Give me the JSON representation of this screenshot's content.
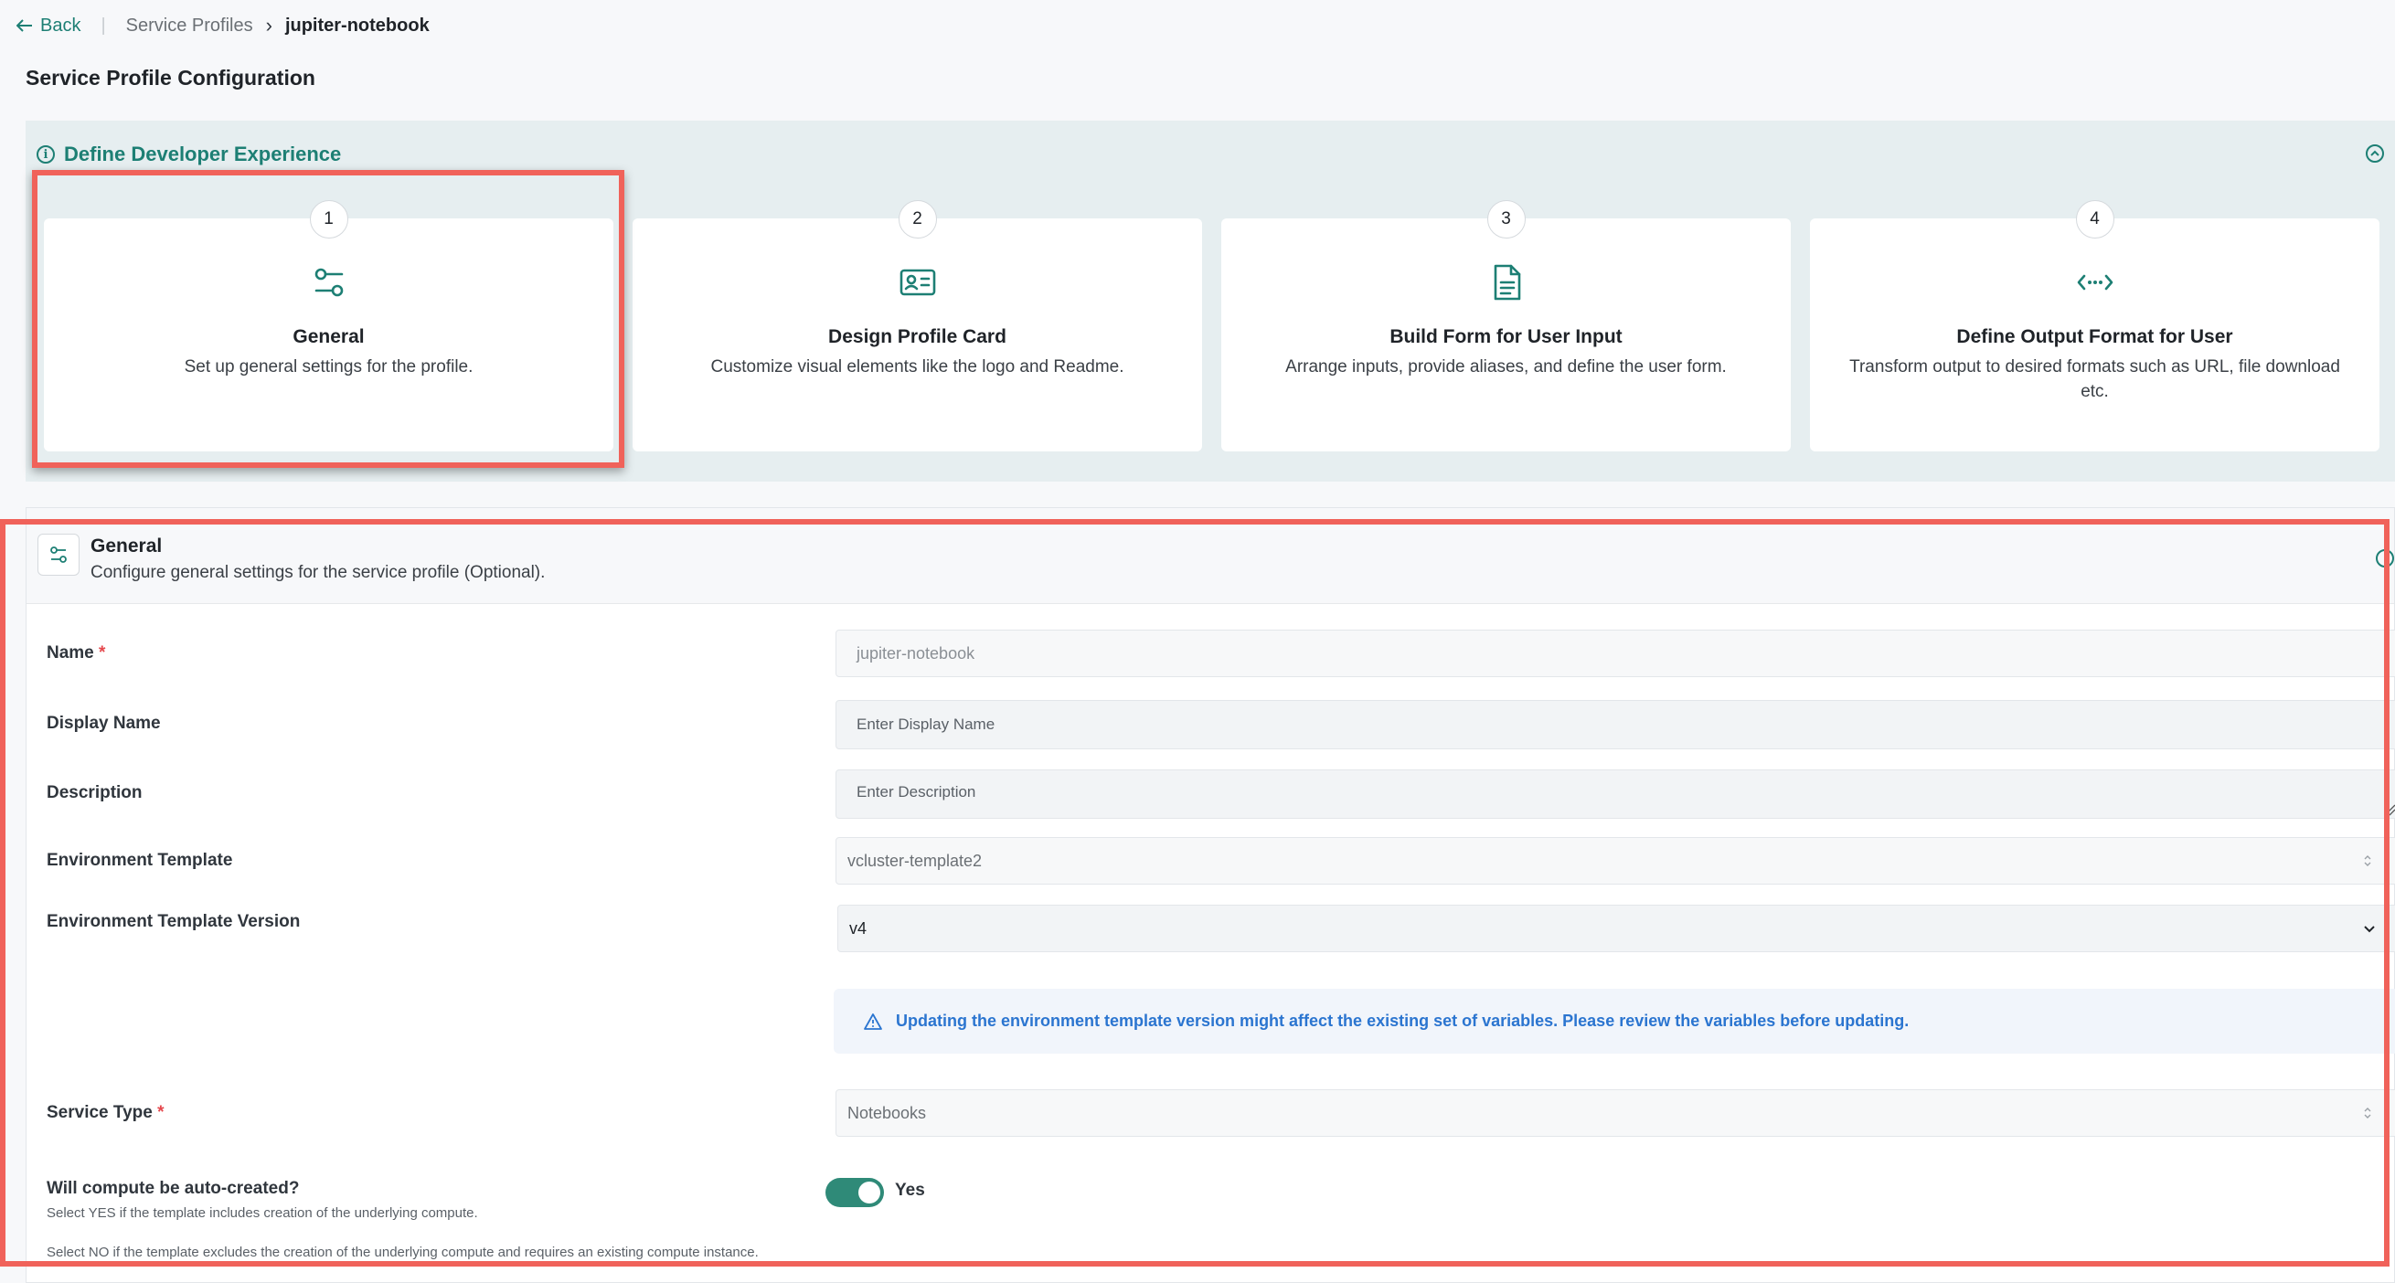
{
  "breadcrumb": {
    "back_label": "Back",
    "parent": "Service Profiles",
    "current": "jupiter-notebook"
  },
  "page_title": "Service Profile Configuration",
  "developer_experience": {
    "title": "Define Developer Experience",
    "steps": [
      {
        "number": "1",
        "icon": "sliders-icon",
        "title": "General",
        "description": "Set up general settings for the profile."
      },
      {
        "number": "2",
        "icon": "id-card-icon",
        "title": "Design Profile Card",
        "description": "Customize visual elements like the logo and Readme."
      },
      {
        "number": "3",
        "icon": "document-icon",
        "title": "Build Form for User Input",
        "description": "Arrange inputs, provide aliases, and define the user form."
      },
      {
        "number": "4",
        "icon": "code-arrows-icon",
        "title": "Define Output Format for User",
        "description": "Transform output to desired formats such as URL, file download etc."
      }
    ]
  },
  "general": {
    "title": "General",
    "subtitle": "Configure general settings for the service profile (Optional).",
    "fields": {
      "name": {
        "label": "Name",
        "required_mark": "*",
        "value": "jupiter-notebook"
      },
      "display_name": {
        "label": "Display Name",
        "placeholder": "Enter Display Name"
      },
      "description": {
        "label": "Description",
        "placeholder": "Enter Description"
      },
      "env_template": {
        "label": "Environment Template",
        "value": "vcluster-template2"
      },
      "env_template_version": {
        "label": "Environment Template Version",
        "value": "v4"
      },
      "service_type": {
        "label": "Service Type",
        "required_mark": "*",
        "value": "Notebooks"
      }
    },
    "version_notice": "Updating the environment template version might affect the existing set of variables. Please review the variables before updating.",
    "auto_create": {
      "label": "Will compute be auto-created?",
      "toggle_on": true,
      "toggle_label": "Yes",
      "help_yes": "Select YES if the template includes creation of the underlying compute.",
      "help_no": "Select NO if the template excludes the creation of the underlying compute and requires an existing compute instance."
    }
  },
  "colors": {
    "accent": "#1d7f74",
    "highlight": "#f0625a",
    "notice_text": "#2b75d0",
    "toggle_on": "#2f8a78"
  }
}
